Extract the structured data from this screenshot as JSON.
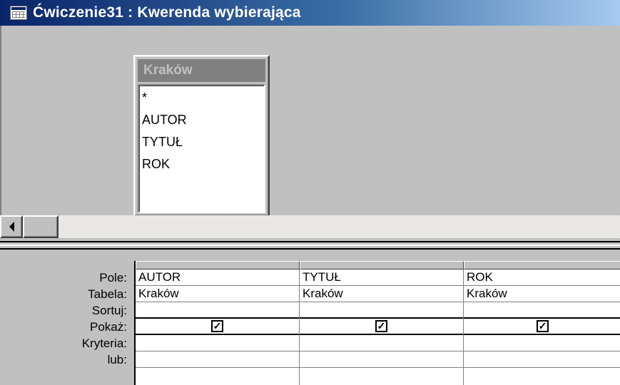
{
  "window": {
    "title": "Ćwiczenie31 : Kwerenda wybierająca",
    "icon": "query-window-icon"
  },
  "table_box": {
    "title": "Kraków",
    "fields": [
      "*",
      "AUTOR",
      "TYTUŁ",
      "ROK"
    ]
  },
  "design_grid": {
    "row_labels": [
      "Pole:",
      "Tabela:",
      "Sortuj:",
      "Pokaż:",
      "Kryteria:",
      "lub:"
    ],
    "columns": [
      {
        "pole": "AUTOR",
        "tabela": "Kraków",
        "sortuj": "",
        "pokaz": true,
        "pokaz_mark": "✓",
        "kryteria": "",
        "lub": ""
      },
      {
        "pole": "TYTUŁ",
        "tabela": "Kraków",
        "sortuj": "",
        "pokaz": true,
        "pokaz_mark": "✓",
        "kryteria": "",
        "lub": ""
      },
      {
        "pole": "ROK",
        "tabela": "Kraków",
        "sortuj": "",
        "pokaz": true,
        "pokaz_mark": "✓",
        "kryteria": "",
        "lub": ""
      }
    ]
  },
  "colors": {
    "title_bar_start": "#0a246a",
    "title_bar_end": "#a6caf0",
    "window_face": "#c0c0c0",
    "grid_background": "#ffffff"
  }
}
